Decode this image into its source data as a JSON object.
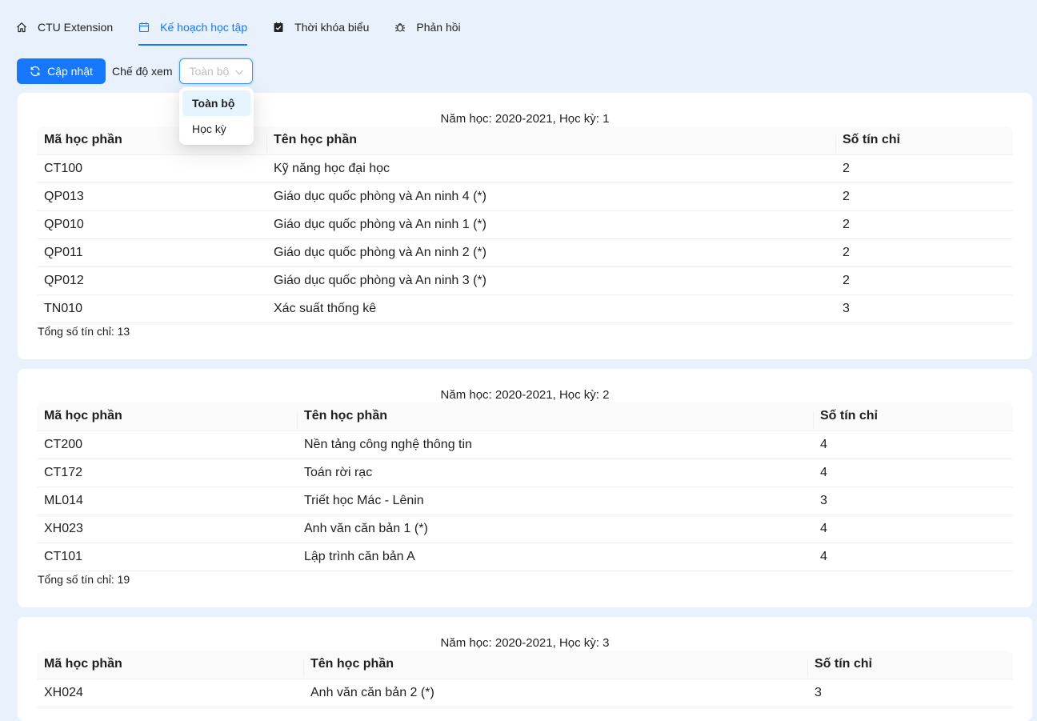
{
  "tabs": [
    {
      "label": "CTU Extension",
      "icon": "home-icon"
    },
    {
      "label": "Kế hoạch học tập",
      "icon": "calendar-icon",
      "active": true
    },
    {
      "label": "Thời khóa biểu",
      "icon": "calendar-check-icon"
    },
    {
      "label": "Phản hồi",
      "icon": "bug-icon"
    }
  ],
  "toolbar": {
    "update_label": "Cập nhật",
    "mode_label": "Chế độ xem",
    "select_value": "Toàn bộ",
    "options": [
      "Toàn bộ",
      "Học kỳ"
    ]
  },
  "colors": {
    "accent": "#1677ff",
    "background": "#e8f1fc"
  },
  "semesters": [
    {
      "title": "Năm học: 2020-2021, Học kỳ: 1",
      "headers": [
        "Mã học phần",
        "Tên học phần",
        "Số tín chỉ"
      ],
      "rows": [
        [
          "CT100",
          "Kỹ năng học đại học",
          "2"
        ],
        [
          "QP013",
          "Giáo dục quốc phòng và An ninh 4 (*)",
          "2"
        ],
        [
          "QP010",
          "Giáo dục quốc phòng và An ninh 1 (*)",
          "2"
        ],
        [
          "QP011",
          "Giáo dục quốc phòng và An ninh 2 (*)",
          "2"
        ],
        [
          "QP012",
          "Giáo dục quốc phòng và An ninh 3 (*)",
          "2"
        ],
        [
          "TN010",
          "Xác suất thống kê",
          "3"
        ]
      ],
      "total": "Tổng số tín chỉ: 13"
    },
    {
      "title": "Năm học: 2020-2021, Học kỳ: 2",
      "headers": [
        "Mã học phần",
        "Tên học phần",
        "Số tín chỉ"
      ],
      "rows": [
        [
          "CT200",
          "Nền tảng công nghệ thông tin",
          "4"
        ],
        [
          "CT172",
          "Toán rời rạc",
          "4"
        ],
        [
          "ML014",
          "Triết học Mác - Lênin",
          "3"
        ],
        [
          "XH023",
          "Anh văn căn bản 1 (*)",
          "4"
        ],
        [
          "CT101",
          "Lập trình căn bản A",
          "4"
        ]
      ],
      "total": "Tổng số tín chỉ: 19"
    },
    {
      "title": "Năm học: 2020-2021, Học kỳ: 3",
      "headers": [
        "Mã học phần",
        "Tên học phần",
        "Số tín chỉ"
      ],
      "rows": [
        [
          "XH024",
          "Anh văn căn bản 2 (*)",
          "3"
        ]
      ],
      "total": ""
    }
  ]
}
